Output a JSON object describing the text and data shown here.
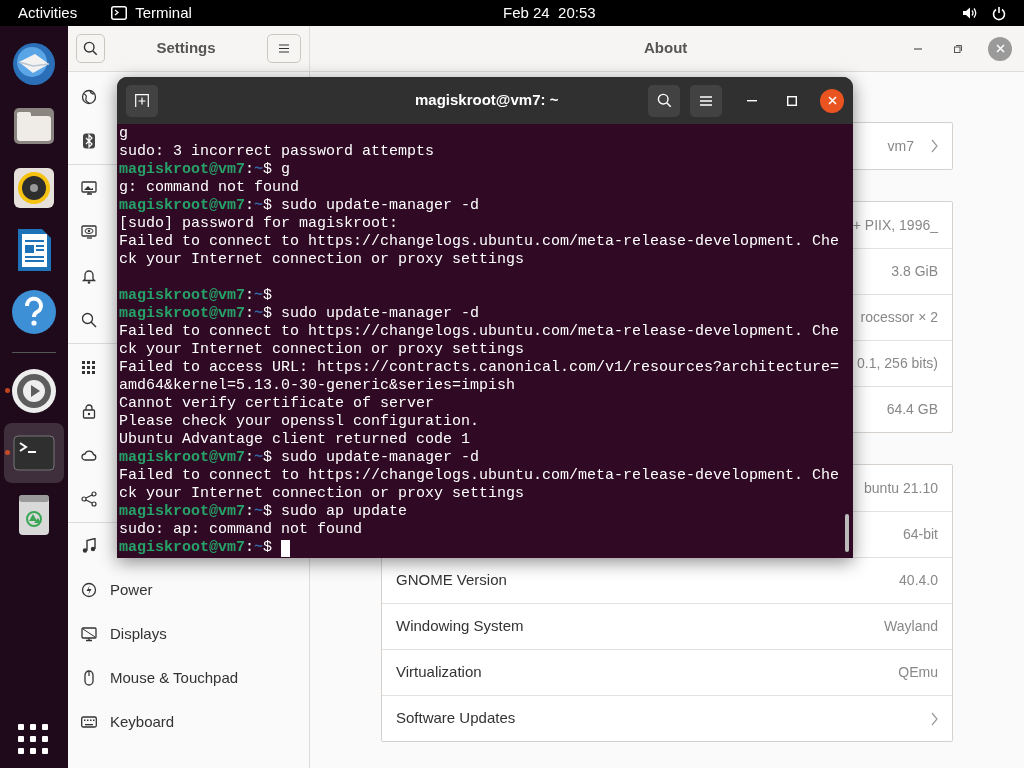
{
  "top_bar": {
    "activities": "Activities",
    "app_name": "Terminal",
    "clock": "Feb 24  20:53"
  },
  "dock": {
    "items": [
      {
        "kind": "mail",
        "running": false,
        "selected": false
      },
      {
        "kind": "files",
        "running": false,
        "selected": false
      },
      {
        "kind": "music",
        "running": false,
        "selected": false
      },
      {
        "kind": "writer",
        "running": false,
        "selected": false
      },
      {
        "kind": "help",
        "running": false,
        "selected": false
      },
      {
        "kind": "separator"
      },
      {
        "kind": "settings",
        "running": true,
        "selected": false
      },
      {
        "kind": "terminal",
        "running": true,
        "selected": true
      },
      {
        "kind": "trash",
        "running": false,
        "selected": false
      }
    ]
  },
  "settings": {
    "title": "Settings",
    "sidebar_groups": [
      [
        {
          "kind": "network",
          "selected": false
        },
        {
          "kind": "bluetooth",
          "selected": false
        }
      ],
      [
        {
          "kind": "background",
          "selected": false
        },
        {
          "kind": "appearance",
          "selected": false
        },
        {
          "kind": "notifications",
          "selected": false
        },
        {
          "kind": "search",
          "selected": false
        }
      ],
      [
        {
          "kind": "applications",
          "selected": false
        },
        {
          "kind": "privacy",
          "selected": false
        },
        {
          "kind": "cloud",
          "selected": false
        },
        {
          "kind": "sharing",
          "selected": false
        }
      ],
      [
        {
          "kind": "sound",
          "selected": false
        },
        {
          "kind": "power",
          "label": "Power",
          "selected": false
        },
        {
          "kind": "displays",
          "label": "Displays",
          "selected": false
        },
        {
          "kind": "mouse",
          "label": "Mouse & Touchpad",
          "selected": false
        },
        {
          "kind": "keyboard",
          "label": "Keyboard",
          "selected": false
        }
      ]
    ]
  },
  "about": {
    "title": "About",
    "groups": [
      {
        "rows": [
          {
            "value": "vm7",
            "chevron": true
          }
        ]
      },
      {
        "rows": [
          {
            "value": "+ PIIX, 1996_"
          },
          {
            "value": "3.8 GiB"
          },
          {
            "value": "rocessor × 2"
          },
          {
            "value": "0.1, 256 bits)"
          },
          {
            "value": "64.4 GB"
          }
        ]
      },
      {
        "rows": [
          {
            "value": "buntu 21.10"
          },
          {
            "value": "64-bit"
          },
          {
            "label": "GNOME Version",
            "value": "40.4.0"
          },
          {
            "label": "Windowing System",
            "value": "Wayland"
          },
          {
            "label": "Virtualization",
            "value": "QEmu"
          },
          {
            "label": "Software Updates",
            "chevron": true
          }
        ]
      }
    ]
  },
  "terminal": {
    "title": "magiskroot@vm7: ~",
    "lines": [
      {
        "kind": "output",
        "text": "g"
      },
      {
        "kind": "output",
        "text": "sudo: 3 incorrect password attempts"
      },
      {
        "kind": "prompt",
        "user": "magiskroot@vm7",
        "sep": ":",
        "path": "~",
        "sign": "$",
        "command": "g"
      },
      {
        "kind": "output",
        "text": "g: command not found"
      },
      {
        "kind": "prompt",
        "user": "magiskroot@vm7",
        "sep": ":",
        "path": "~",
        "sign": "$",
        "command": "sudo update-manager -d"
      },
      {
        "kind": "output",
        "text": "[sudo] password for magiskroot:"
      },
      {
        "kind": "output",
        "text": "Failed to connect to https://changelogs.ubuntu.com/meta-release-development. Che"
      },
      {
        "kind": "output",
        "text": "ck your Internet connection or proxy settings"
      },
      {
        "kind": "blank"
      },
      {
        "kind": "prompt",
        "user": "magiskroot@vm7",
        "sep": ":",
        "path": "~",
        "sign": "$"
      },
      {
        "kind": "prompt",
        "user": "magiskroot@vm7",
        "sep": ":",
        "path": "~",
        "sign": "$",
        "command": "sudo update-manager -d"
      },
      {
        "kind": "output",
        "text": "Failed to connect to https://changelogs.ubuntu.com/meta-release-development. Che"
      },
      {
        "kind": "output",
        "text": "ck your Internet connection or proxy settings"
      },
      {
        "kind": "output",
        "text": "Failed to access URL: https://contracts.canonical.com/v1/resources?architecture="
      },
      {
        "kind": "output",
        "text": "amd64&kernel=5.13.0-30-generic&series=impish"
      },
      {
        "kind": "output",
        "text": "Cannot verify certificate of server"
      },
      {
        "kind": "output",
        "text": "Please check your openssl configuration."
      },
      {
        "kind": "output",
        "text": "Ubuntu Advantage client returned code 1"
      },
      {
        "kind": "prompt",
        "user": "magiskroot@vm7",
        "sep": ":",
        "path": "~",
        "sign": "$",
        "command": "sudo update-manager -d"
      },
      {
        "kind": "output",
        "text": "Failed to connect to https://changelogs.ubuntu.com/meta-release-development. Che"
      },
      {
        "kind": "output",
        "text": "ck your Internet connection or proxy settings"
      },
      {
        "kind": "prompt",
        "user": "magiskroot@vm7",
        "sep": ":",
        "path": "~",
        "sign": "$",
        "command": "sudo ap update"
      },
      {
        "kind": "output",
        "text": "sudo: ap: command not found"
      },
      {
        "kind": "prompt",
        "user": "magiskroot@vm7",
        "sep": ":",
        "path": "~",
        "sign": "$",
        "cursor": true
      }
    ]
  }
}
